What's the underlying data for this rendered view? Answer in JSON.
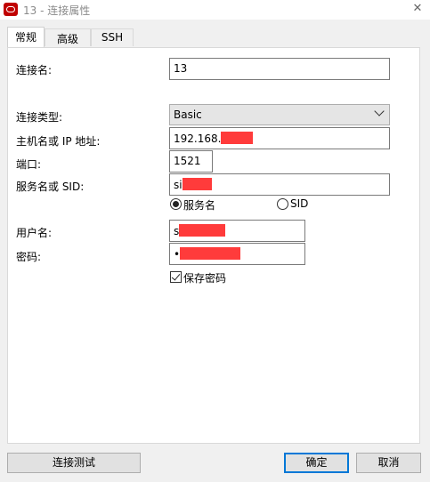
{
  "window": {
    "title": "13 - 连接属性",
    "close_glyph": "✕",
    "brand_color": "#c00000"
  },
  "tabs": [
    {
      "label": "常规",
      "active": true
    },
    {
      "label": "高级",
      "active": false
    },
    {
      "label": "SSH",
      "active": false
    }
  ],
  "form": {
    "connection_name_label": "连接名:",
    "connection_name_value": "13",
    "connection_type_label": "连接类型:",
    "connection_type_value": "Basic",
    "host_label": "主机名或 IP 地址:",
    "host_value": "192.168.",
    "port_label": "端口:",
    "port_value": "1521",
    "service_label": "服务名或 SID:",
    "service_value": "si",
    "service_radio_label": "服务名",
    "sid_radio_label": "SID",
    "username_label": "用户名:",
    "username_value": "s",
    "password_label": "密码:",
    "password_value": "•",
    "save_password_label": "保存密码",
    "save_password_checked": true,
    "redaction_color": "#ff3b3b"
  },
  "buttons": {
    "test_label": "连接测试",
    "ok_label": "确定",
    "cancel_label": "取消"
  }
}
